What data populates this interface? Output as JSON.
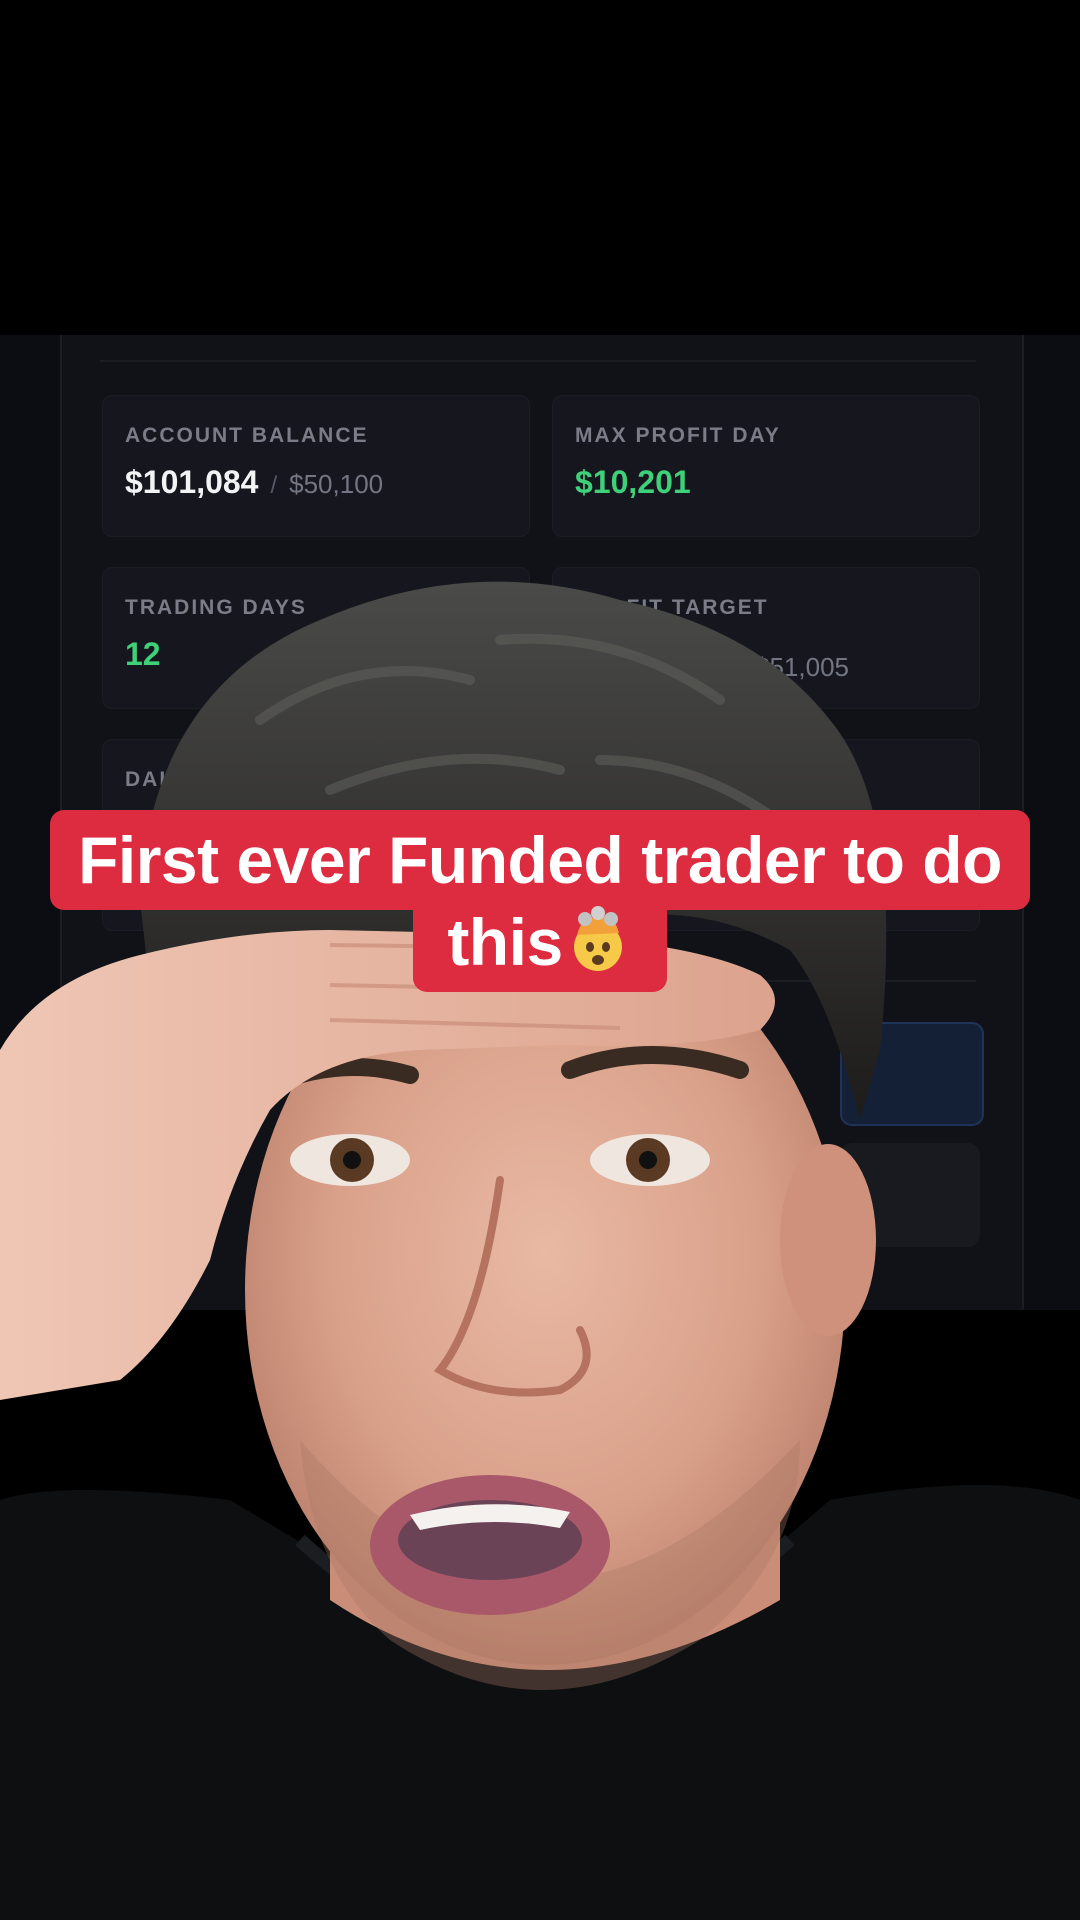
{
  "dashboard": {
    "cards": [
      {
        "label": "ACCOUNT BALANCE",
        "value": "$101,084",
        "sub": "$50,100"
      },
      {
        "label": "MAX PROFIT DAY",
        "value": "$10,201"
      },
      {
        "label": "TRADING DAYS",
        "value": "12"
      },
      {
        "label": "PROFIT TARGET",
        "sub": "$51,005"
      },
      {
        "label": "DAI"
      }
    ],
    "separator": "/",
    "colors": {
      "background": "#0c0d12",
      "card": "#16171e",
      "label": "#7a7d88",
      "value": "#f2f3f5",
      "positive": "#3fd07a",
      "accent_blue": "#142036"
    }
  },
  "caption": {
    "line1": "First ever Funded trader to do",
    "line2": "this",
    "emoji_icon": "exploding-head-icon",
    "color": "#dd2b40"
  }
}
